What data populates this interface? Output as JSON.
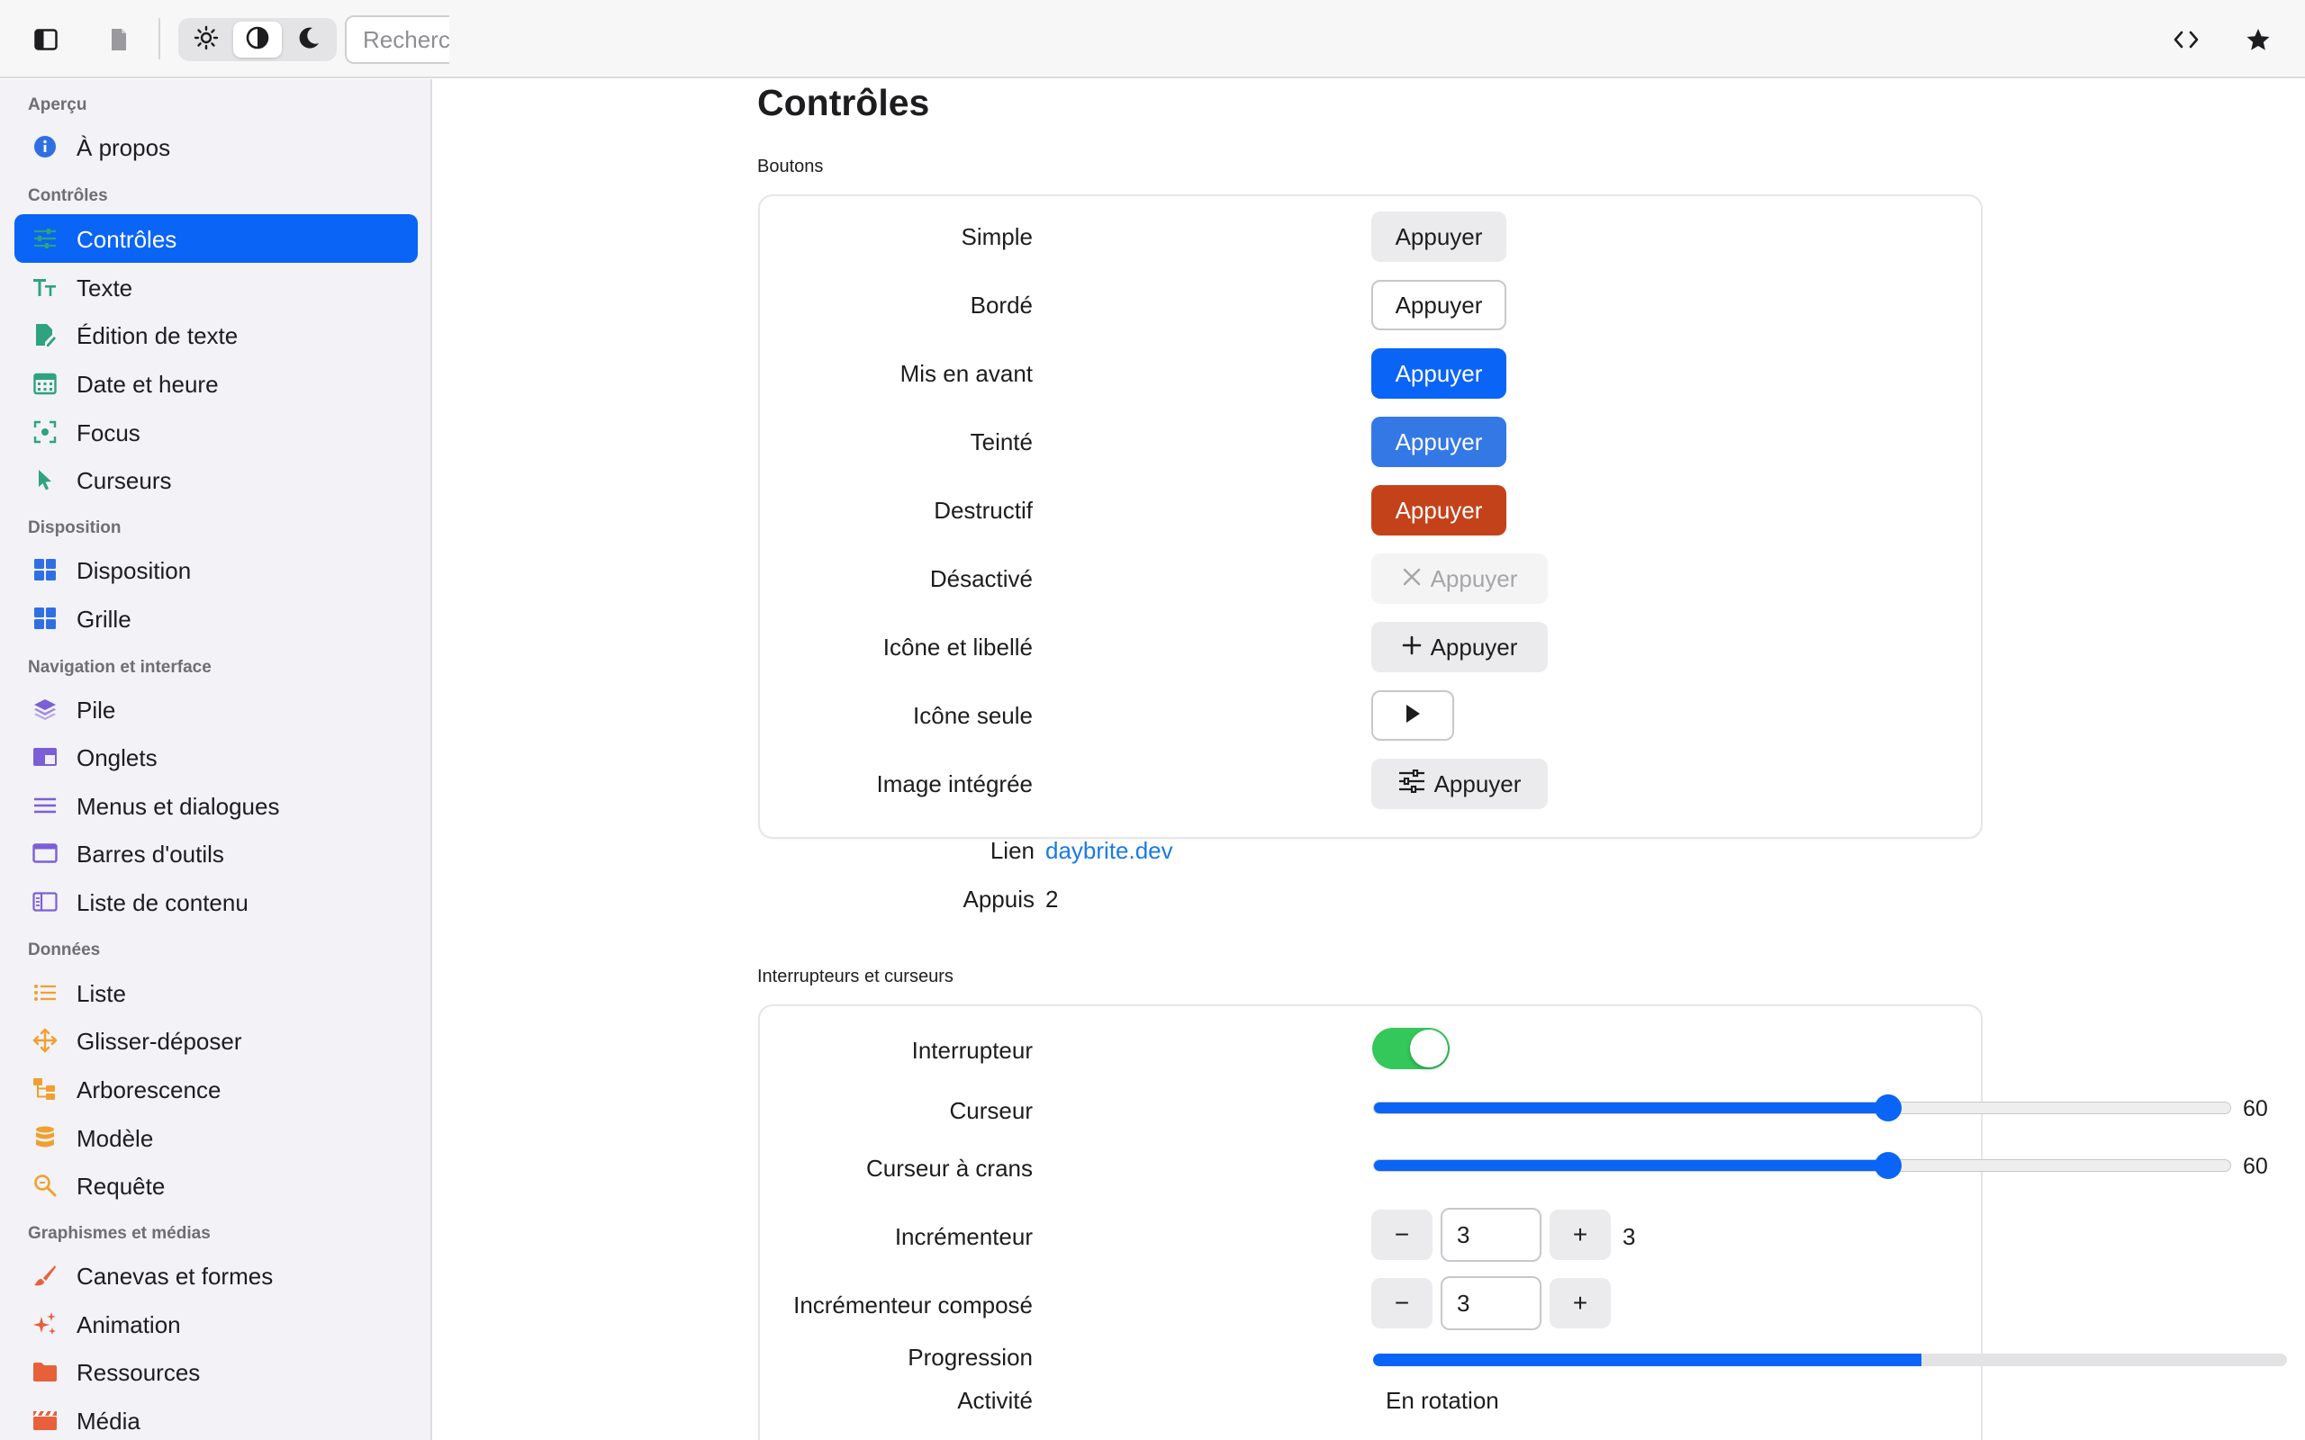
{
  "toolbar": {
    "sidebar_toggle_icon": "sidebar-icon",
    "document_icon": "document-icon",
    "theme_light_icon": "sun-icon",
    "theme_auto_icon": "half-circle-icon",
    "theme_dark_icon": "moon-icon",
    "search_placeholder": "Rechercher",
    "code_icon": "code-icon",
    "favorite_icon": "star-icon"
  },
  "sidebar": {
    "sections": [
      {
        "title": "Aperçu",
        "items": [
          {
            "label": "À propos",
            "icon": "info-icon",
            "color": "#2f6fe4"
          }
        ]
      },
      {
        "title": "Contrôles",
        "items": [
          {
            "label": "Contrôles",
            "icon": "sliders-icon",
            "color": "#2ea37d",
            "selected": true
          },
          {
            "label": "Texte",
            "icon": "text-icon",
            "color": "#2ea37d"
          },
          {
            "label": "Édition de texte",
            "icon": "edit-icon",
            "color": "#2ea37d"
          },
          {
            "label": "Date et heure",
            "icon": "calendar-icon",
            "color": "#2ea37d"
          },
          {
            "label": "Focus",
            "icon": "focus-icon",
            "color": "#2ea37d"
          },
          {
            "label": "Curseurs",
            "icon": "pointer-icon",
            "color": "#2ea37d"
          }
        ]
      },
      {
        "title": "Disposition",
        "items": [
          {
            "label": "Disposition",
            "icon": "layout-icon",
            "color": "#2f6fe4"
          },
          {
            "label": "Grille",
            "icon": "grid-icon",
            "color": "#2f6fe4"
          }
        ]
      },
      {
        "title": "Navigation et interface",
        "items": [
          {
            "label": "Pile",
            "icon": "stack-icon",
            "color": "#7b5fd6"
          },
          {
            "label": "Onglets",
            "icon": "tabs-icon",
            "color": "#7b5fd6"
          },
          {
            "label": "Menus et dialogues",
            "icon": "menu-icon",
            "color": "#7b5fd6"
          },
          {
            "label": "Barres d'outils",
            "icon": "window-icon",
            "color": "#7b5fd6"
          },
          {
            "label": "Liste de contenu",
            "icon": "columns-icon",
            "color": "#7b5fd6"
          }
        ]
      },
      {
        "title": "Données",
        "items": [
          {
            "label": "Liste",
            "icon": "list-icon",
            "color": "#f0a030"
          },
          {
            "label": "Glisser-déposer",
            "icon": "move-icon",
            "color": "#f0a030"
          },
          {
            "label": "Arborescence",
            "icon": "tree-icon",
            "color": "#f0a030"
          },
          {
            "label": "Modèle",
            "icon": "database-icon",
            "color": "#f0a030"
          },
          {
            "label": "Requête",
            "icon": "magnifier-icon",
            "color": "#f0a030"
          }
        ]
      },
      {
        "title": "Graphismes et médias",
        "items": [
          {
            "label": "Canevas et formes",
            "icon": "brush-icon",
            "color": "#e8603a"
          },
          {
            "label": "Animation",
            "icon": "sparkles-icon",
            "color": "#e8603a"
          },
          {
            "label": "Ressources",
            "icon": "folder-icon",
            "color": "#e8603a"
          },
          {
            "label": "Média",
            "icon": "clapper-icon",
            "color": "#e8603a"
          }
        ]
      }
    ]
  },
  "main": {
    "title": "Contrôles",
    "buttons_group": {
      "label": "Boutons",
      "rows": [
        {
          "label": "Simple",
          "button": "Appuyer"
        },
        {
          "label": "Bordé",
          "button": "Appuyer"
        },
        {
          "label": "Mis en avant",
          "button": "Appuyer"
        },
        {
          "label": "Teinté",
          "button": "Appuyer"
        },
        {
          "label": "Destructif",
          "button": "Appuyer"
        },
        {
          "label": "Désactivé",
          "button": "Appuyer"
        },
        {
          "label": "Icône et libellé",
          "button": "Appuyer"
        },
        {
          "label": "Icône seule",
          "button": ""
        },
        {
          "label": "Image intégrée",
          "button": "Appuyer"
        },
        {
          "label": "Lien",
          "link": "daybrite.dev"
        },
        {
          "label": "Appuis",
          "value": "2"
        }
      ]
    },
    "toggles_group": {
      "label": "Interrupteurs et curseurs",
      "switch": {
        "label": "Interrupteur",
        "on": true
      },
      "slider": {
        "label": "Curseur",
        "value": 60,
        "min": 0,
        "max": 100,
        "display": "60"
      },
      "stepped_slider": {
        "label": "Curseur à crans",
        "value": 60,
        "min": 0,
        "max": 100,
        "display": "60"
      },
      "stepper": {
        "label": "Incrémenteur",
        "value": "3",
        "display": "3",
        "minus": "−",
        "plus": "+"
      },
      "compound_stepper": {
        "label": "Incrémenteur composé",
        "value": "3",
        "minus": "−",
        "plus": "+"
      },
      "progress": {
        "label": "Progression",
        "fraction": 0.6
      },
      "activity": {
        "label": "Activité",
        "value": "En rotation"
      }
    }
  },
  "colors": {
    "accent": "#0a64f5",
    "tinted": "#3478e6",
    "destructive": "#c4421a",
    "switch_on": "#34c759",
    "link": "#1a7ae6"
  }
}
